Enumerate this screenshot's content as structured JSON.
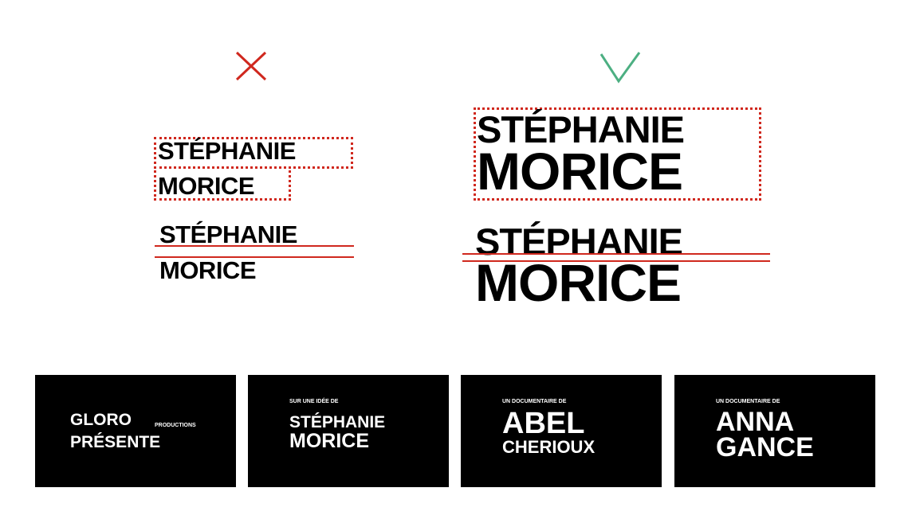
{
  "colors": {
    "wrong": "#d0281e",
    "correct": "#4caf82",
    "card_bg": "#000000",
    "text": "#000000",
    "card_text": "#ffffff"
  },
  "marks": {
    "wrong_icon": "cross-icon",
    "correct_icon": "check-icon"
  },
  "wrong_example": {
    "boxed": {
      "line1": "STÉPHANIE",
      "line2": "MORICE"
    },
    "lined": {
      "line1": "STÉPHANIE",
      "line2": "MORICE"
    }
  },
  "correct_example": {
    "boxed": {
      "line1": "STÉPHANIE",
      "line2": "MORICE"
    },
    "lined": {
      "line1": "STÉPHANIE",
      "line2": "MORICE"
    }
  },
  "cards": [
    {
      "line1": "GLORO",
      "suffix": "PRODUCTIONS",
      "line2": "PRÉSENTE"
    },
    {
      "kicker": "SUR UNE IDÉE DE",
      "line1": "STÉPHANIE",
      "line2": "MORICE"
    },
    {
      "kicker": "UN DOCUMENTAIRE DE",
      "line1": "ABEL",
      "line2": "CHERIOUX"
    },
    {
      "kicker": "UN DOCUMENTAIRE DE",
      "line1": "ANNA",
      "line2": "GANCE"
    }
  ]
}
